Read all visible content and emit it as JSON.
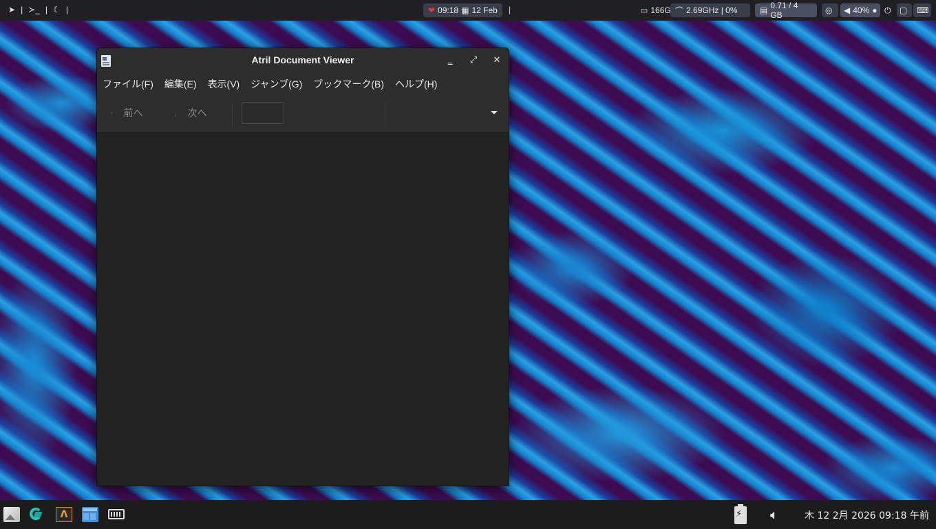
{
  "top_panel": {
    "left_items": [
      "|",
      "|",
      "|"
    ],
    "clock": {
      "time": "09:18",
      "date": "12 Feb"
    },
    "separator": "|",
    "disk": "166G",
    "cpu": "2.69GHz | 0%",
    "memory": "0.71 / 4 GB",
    "volume": "40%"
  },
  "window": {
    "title": "Atril Document Viewer",
    "menu": [
      "ファイル(F)",
      "編集(E)",
      "表示(V)",
      "ジャンプ(G)",
      "ブックマーク(B)",
      "ヘルプ(H)"
    ],
    "toolbar": {
      "prev_label": "前へ",
      "next_label": "次へ",
      "page_value": "",
      "zoom_value": ""
    }
  },
  "bottom_panel": {
    "launchers": [
      "files-launcher",
      "code-editor-launcher",
      "terminal-launcher",
      "window-manager-launcher",
      "keyboard-launcher"
    ],
    "clock": "木 12  2月 2026 09:18 午前"
  }
}
